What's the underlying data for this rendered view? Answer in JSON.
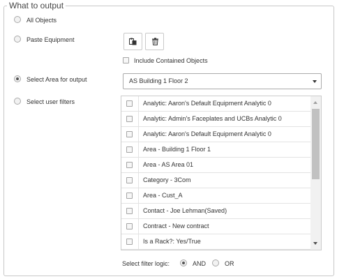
{
  "section": {
    "legend": "What to output"
  },
  "options": {
    "all_objects": {
      "label": "All Objects",
      "checked": false
    },
    "paste_equipment": {
      "label": "Paste Equipment",
      "checked": false
    },
    "select_area": {
      "label": "Select Area for output",
      "checked": true
    },
    "select_filters": {
      "label": "Select user filters",
      "checked": false
    }
  },
  "paste": {
    "paste_icon": "paste-icon",
    "delete_icon": "trash-icon",
    "include_contained_label": "Include Contained Objects",
    "include_contained_checked": false
  },
  "area_select": {
    "value": "AS Building 1 Floor 2"
  },
  "filters": [
    {
      "label": "Analytic: Aaron's Default Equipment Analytic 0",
      "checked": false
    },
    {
      "label": "Analytic: Admin's Faceplates and UCBs Analytic 0",
      "checked": false
    },
    {
      "label": "Analytic: Aaron's Default Equipment Analytic 0",
      "checked": false
    },
    {
      "label": "Area - Building 1 Floor 1",
      "checked": false
    },
    {
      "label": "Area - AS Area 01",
      "checked": false
    },
    {
      "label": "Category - 3Com",
      "checked": false
    },
    {
      "label": "Area - Cust_A",
      "checked": false
    },
    {
      "label": "Contact - Joe Lehman(Saved)",
      "checked": false
    },
    {
      "label": "Contract - New contract",
      "checked": false
    },
    {
      "label": "Is a Rack?: Yes/True",
      "checked": false
    }
  ],
  "filter_logic": {
    "label": "Select filter logic:",
    "and_label": "AND",
    "or_label": "OR",
    "selected": "AND"
  }
}
